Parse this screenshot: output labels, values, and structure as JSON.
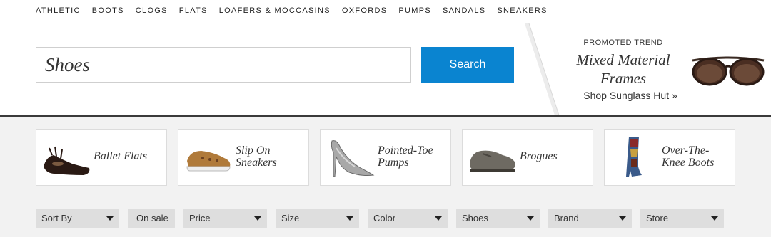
{
  "nav": {
    "items": [
      {
        "label": "ATHLETIC"
      },
      {
        "label": "BOOTS"
      },
      {
        "label": "CLOGS"
      },
      {
        "label": "FLATS"
      },
      {
        "label": "LOAFERS & MOCCASINS"
      },
      {
        "label": "OXFORDS"
      },
      {
        "label": "PUMPS"
      },
      {
        "label": "SANDALS"
      },
      {
        "label": "SNEAKERS"
      }
    ]
  },
  "search": {
    "value": "Shoes",
    "button_label": "Search"
  },
  "promo": {
    "eyebrow": "PROMOTED TREND",
    "title_line1": "Mixed Material",
    "title_line2": "Frames",
    "link": "Shop Sunglass Hut »",
    "image_icon": "sunglasses-icon"
  },
  "categories": [
    {
      "line1": "Ballet Flats",
      "line2": "",
      "icon": "ballet-flat-shoe-icon"
    },
    {
      "line1": "Slip On",
      "line2": "Sneakers",
      "icon": "slip-on-sneaker-icon"
    },
    {
      "line1": "Pointed-Toe",
      "line2": "Pumps",
      "icon": "pointed-toe-pump-icon"
    },
    {
      "line1": "Brogues",
      "line2": "",
      "icon": "brogue-shoe-icon"
    },
    {
      "line1": "Over-The-",
      "line2": "Knee Boots",
      "icon": "over-knee-boot-icon"
    }
  ],
  "filters": [
    {
      "label": "Sort By",
      "dropdown": true
    },
    {
      "label": "On sale",
      "dropdown": false
    },
    {
      "label": "Price",
      "dropdown": true
    },
    {
      "label": "Size",
      "dropdown": true
    },
    {
      "label": "Color",
      "dropdown": true
    },
    {
      "label": "Shoes",
      "dropdown": true
    },
    {
      "label": "Brand",
      "dropdown": true
    },
    {
      "label": "Store",
      "dropdown": true
    }
  ],
  "colors": {
    "accent": "#0a84d0",
    "panel": "#f2f2f2",
    "filter_bg": "#dedede"
  }
}
